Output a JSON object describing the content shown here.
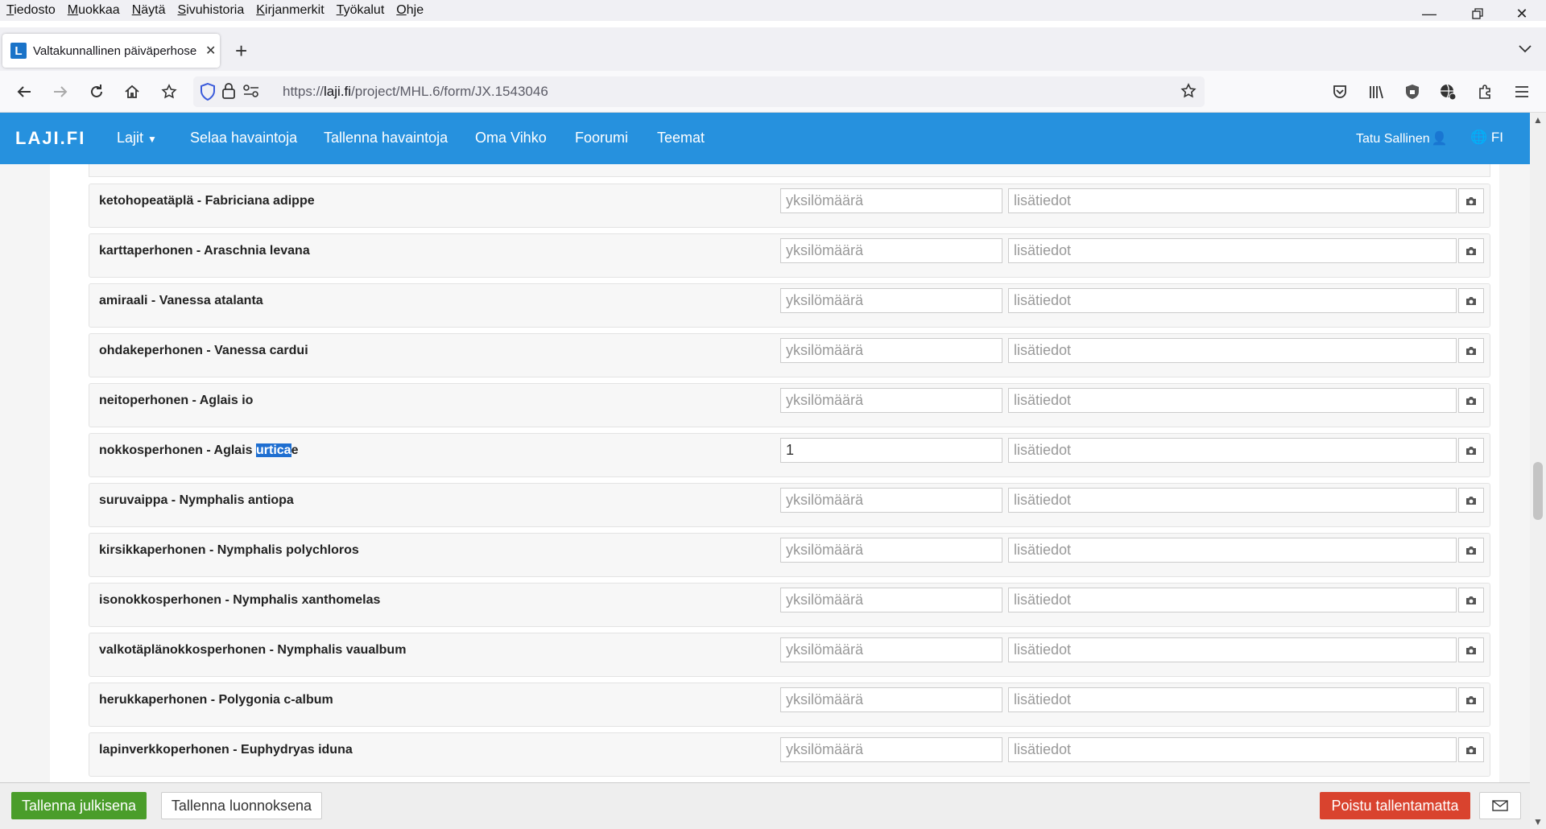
{
  "menu": [
    "Tiedosto",
    "Muokkaa",
    "Näytä",
    "Sivuhistoria",
    "Kirjanmerkit",
    "Työkalut",
    "Ohje"
  ],
  "tab": {
    "title": "Valtakunnallinen päiväperhose",
    "favicon": "L"
  },
  "url": {
    "prefix": "https://",
    "host": "laji.fi",
    "path": "/project/MHL.6/form/JX.1543046"
  },
  "header": {
    "brand": "LAJI.FI",
    "nav": [
      "Lajit",
      "Selaa havaintoja",
      "Tallenna havaintoja",
      "Oma Vihko",
      "Foorumi",
      "Teemat"
    ],
    "user": "Tatu Sallinen",
    "lang": "FI"
  },
  "form": {
    "count_placeholder": "yksilömäärä",
    "info_placeholder": "lisätiedot",
    "rows": [
      {
        "name": "ketohopeatäplä - Fabriciana adippe",
        "count": ""
      },
      {
        "name": "karttaperhonen - Araschnia levana",
        "count": ""
      },
      {
        "name": "amiraali - Vanessa atalanta",
        "count": ""
      },
      {
        "name": "ohdakeperhonen - Vanessa cardui",
        "count": ""
      },
      {
        "name": "neitoperhonen - Aglais io",
        "count": ""
      },
      {
        "name": "nokkosperhonen - Aglais urticae",
        "count": "1"
      },
      {
        "name": "suruvaippa - Nymphalis antiopa",
        "count": ""
      },
      {
        "name": "kirsikkaperhonen - Nymphalis polychloros",
        "count": ""
      },
      {
        "name": "isonokkosperhonen - Nymphalis xanthomelas",
        "count": ""
      },
      {
        "name": "valkotäplänokkosperhonen - Nymphalis vaualbum",
        "count": ""
      },
      {
        "name": "herukkaperhonen - Polygonia c-album",
        "count": ""
      },
      {
        "name": "lapinverkkoperhonen - Euphydryas iduna",
        "count": ""
      }
    ],
    "highlight": {
      "row": 5,
      "before": "nokkosperhonen - Aglais ",
      "selected": "urtica",
      "after": "e"
    }
  },
  "footer": {
    "save_public": "Tallenna julkisena",
    "save_draft": "Tallenna luonnoksena",
    "discard": "Poistu tallentamatta"
  },
  "colors": {
    "brand_blue": "#2691de",
    "save_green": "#4a9d2a",
    "discard_red": "#d9432e"
  }
}
